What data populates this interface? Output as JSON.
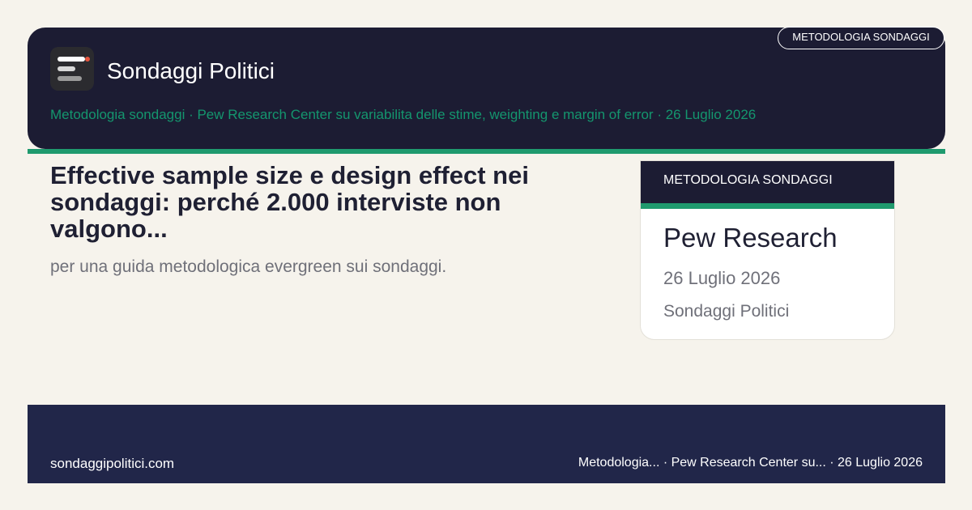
{
  "header": {
    "logo_icon": "lines-logo-icon",
    "site_name": "Sondaggi Politici",
    "subtitle": "Metodologia sondaggi · Pew Research Center su variabilita delle stime, weighting e margin of error · 26 Luglio 2026",
    "category_pill": "METODOLOGIA SONDAGGI"
  },
  "article": {
    "title": "Effective sample size e design effect nei sondaggi: perché 2.000 interviste non valgono...",
    "excerpt": "per una guida metodologica evergreen sui sondaggi."
  },
  "card": {
    "category": "METODOLOGIA SONDAGGI",
    "source": "Pew Research",
    "date": "26 Luglio 2026",
    "site": "Sondaggi Politici"
  },
  "footer": {
    "url": "sondaggipolitici.com",
    "meta": "Metodologia... · Pew Research Center su... · 26 Luglio 2026"
  },
  "colors": {
    "header_bg": "#1c1c33",
    "accent_green": "#1f9a6e",
    "footer_bg": "#212649",
    "page_bg": "#f6f3ec"
  }
}
